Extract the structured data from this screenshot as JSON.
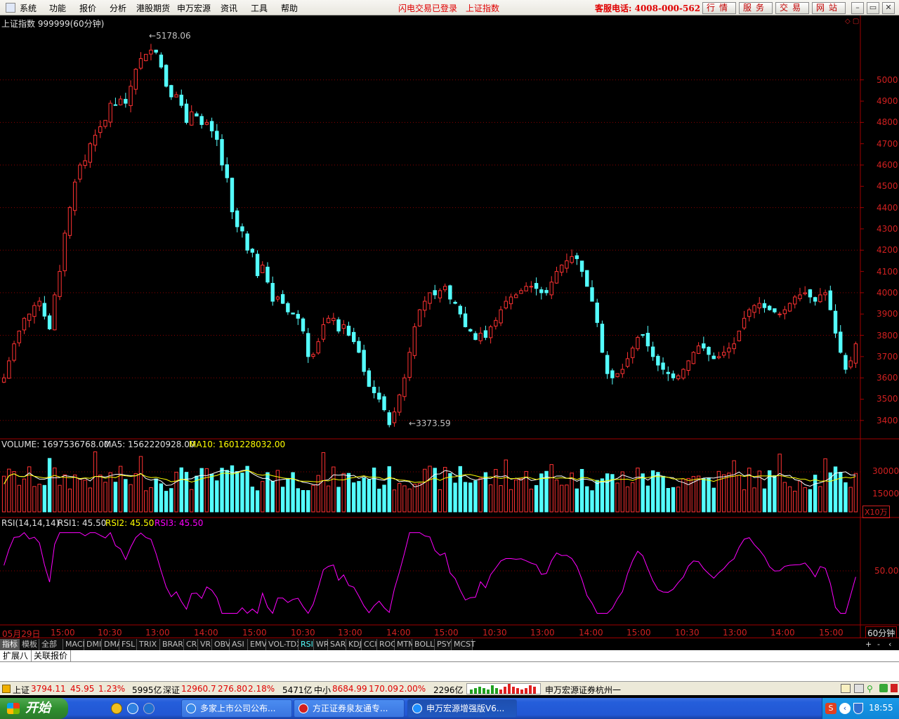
{
  "menu": [
    "系统",
    "功能",
    "报价",
    "分析",
    "港股期货",
    "申万宏源",
    "资讯",
    "工具",
    "帮助"
  ],
  "status_login": "闪电交易已登录",
  "status_index": "上证指数",
  "hotline": "客服电话: 4008-000-562",
  "top_buttons": [
    "行情",
    "服务",
    "交易",
    "网站"
  ],
  "chart": {
    "title": "上证指数 999999(60分钟)",
    "high_label": "5178.06",
    "low_label": "3373.59",
    "price_axis": [
      "5000",
      "4900",
      "4800",
      "4700",
      "4600",
      "4500",
      "4400",
      "4300",
      "4200",
      "4100",
      "4000",
      "3900",
      "3800",
      "3700",
      "3600",
      "3500",
      "3400"
    ],
    "volume_header": {
      "volume": "VOLUME: 1697536768.00",
      "ma5": "MA5: 1562220928.00",
      "ma10": "MA10: 1601228032.00"
    },
    "volume_axis": [
      "30000",
      "15000"
    ],
    "volume_unit": "X10万",
    "rsi_header": {
      "rsi": "RSI(14,14,14)",
      "rsi1": "RSI1: 45.50",
      "rsi2": "RSI2: 45.50",
      "rsi3": "RSI3: 45.50"
    },
    "rsi_axis": "50.00",
    "time_axis": [
      "05月29日",
      "15:00",
      "10:30",
      "13:00",
      "14:00",
      "15:00",
      "10:30",
      "13:00",
      "14:00",
      "15:00",
      "10:30",
      "13:00",
      "14:00",
      "15:00",
      "10:30",
      "13:00",
      "14:00",
      "15:00"
    ],
    "period_label": "60分钟",
    "colors": {
      "up": "#ff3232",
      "down": "#54ffff",
      "grid": "#8b0000",
      "ma5": "#ffffff",
      "ma10": "#ffff00",
      "rsi": "#ff00ff"
    }
  },
  "chart_data": {
    "type": "candlestick",
    "title": "上证指数 999999(60分钟)",
    "ylim": [
      3340,
      5230
    ],
    "close_approx": [
      3600,
      3680,
      3760,
      3820,
      3880,
      3900,
      3940,
      3960,
      3890,
      3830,
      3990,
      4100,
      4280,
      4400,
      4520,
      4600,
      4620,
      4700,
      4740,
      4780,
      4810,
      4890,
      4880,
      4910,
      4890,
      4970,
      5050,
      5100,
      5120,
      5140,
      5130,
      5060,
      4970,
      4920,
      4930,
      4880,
      4800,
      4850,
      4830,
      4790,
      4800,
      4760,
      4720,
      4600,
      4540,
      4380,
      4310,
      4290,
      4200,
      4190,
      4080,
      4130,
      4050,
      3960,
      3980,
      3950,
      3910,
      3900,
      3880,
      3820,
      3700,
      3710,
      3770,
      3850,
      3880,
      3880,
      3820,
      3850,
      3800,
      3770,
      3720,
      3630,
      3560,
      3530,
      3500,
      3450,
      3380,
      3440,
      3520,
      3600,
      3720,
      3840,
      3920,
      3960,
      4000,
      3990,
      4010,
      4030,
      3970,
      3950,
      3900,
      3840,
      3820,
      3780,
      3810,
      3790,
      3840,
      3870,
      3920,
      3960,
      3980,
      3990,
      4010,
      4030,
      4030,
      4020,
      4000,
      4000,
      4050,
      4100,
      4130,
      4150,
      4170,
      4160,
      4100,
      4030,
      3960,
      3860,
      3720,
      3620,
      3600,
      3620,
      3640,
      3690,
      3740,
      3790,
      3800,
      3750,
      3700,
      3660,
      3640,
      3620,
      3600,
      3610,
      3640,
      3680,
      3720,
      3750,
      3740,
      3710,
      3690,
      3700,
      3720,
      3740,
      3760,
      3820,
      3880,
      3920,
      3940,
      3950,
      3930,
      3920,
      3910,
      3900,
      3920,
      3950,
      3980,
      3990,
      4000,
      3980,
      3960,
      3990,
      4000,
      3920,
      3810,
      3720,
      3640,
      3680,
      3760
    ]
  }
}
